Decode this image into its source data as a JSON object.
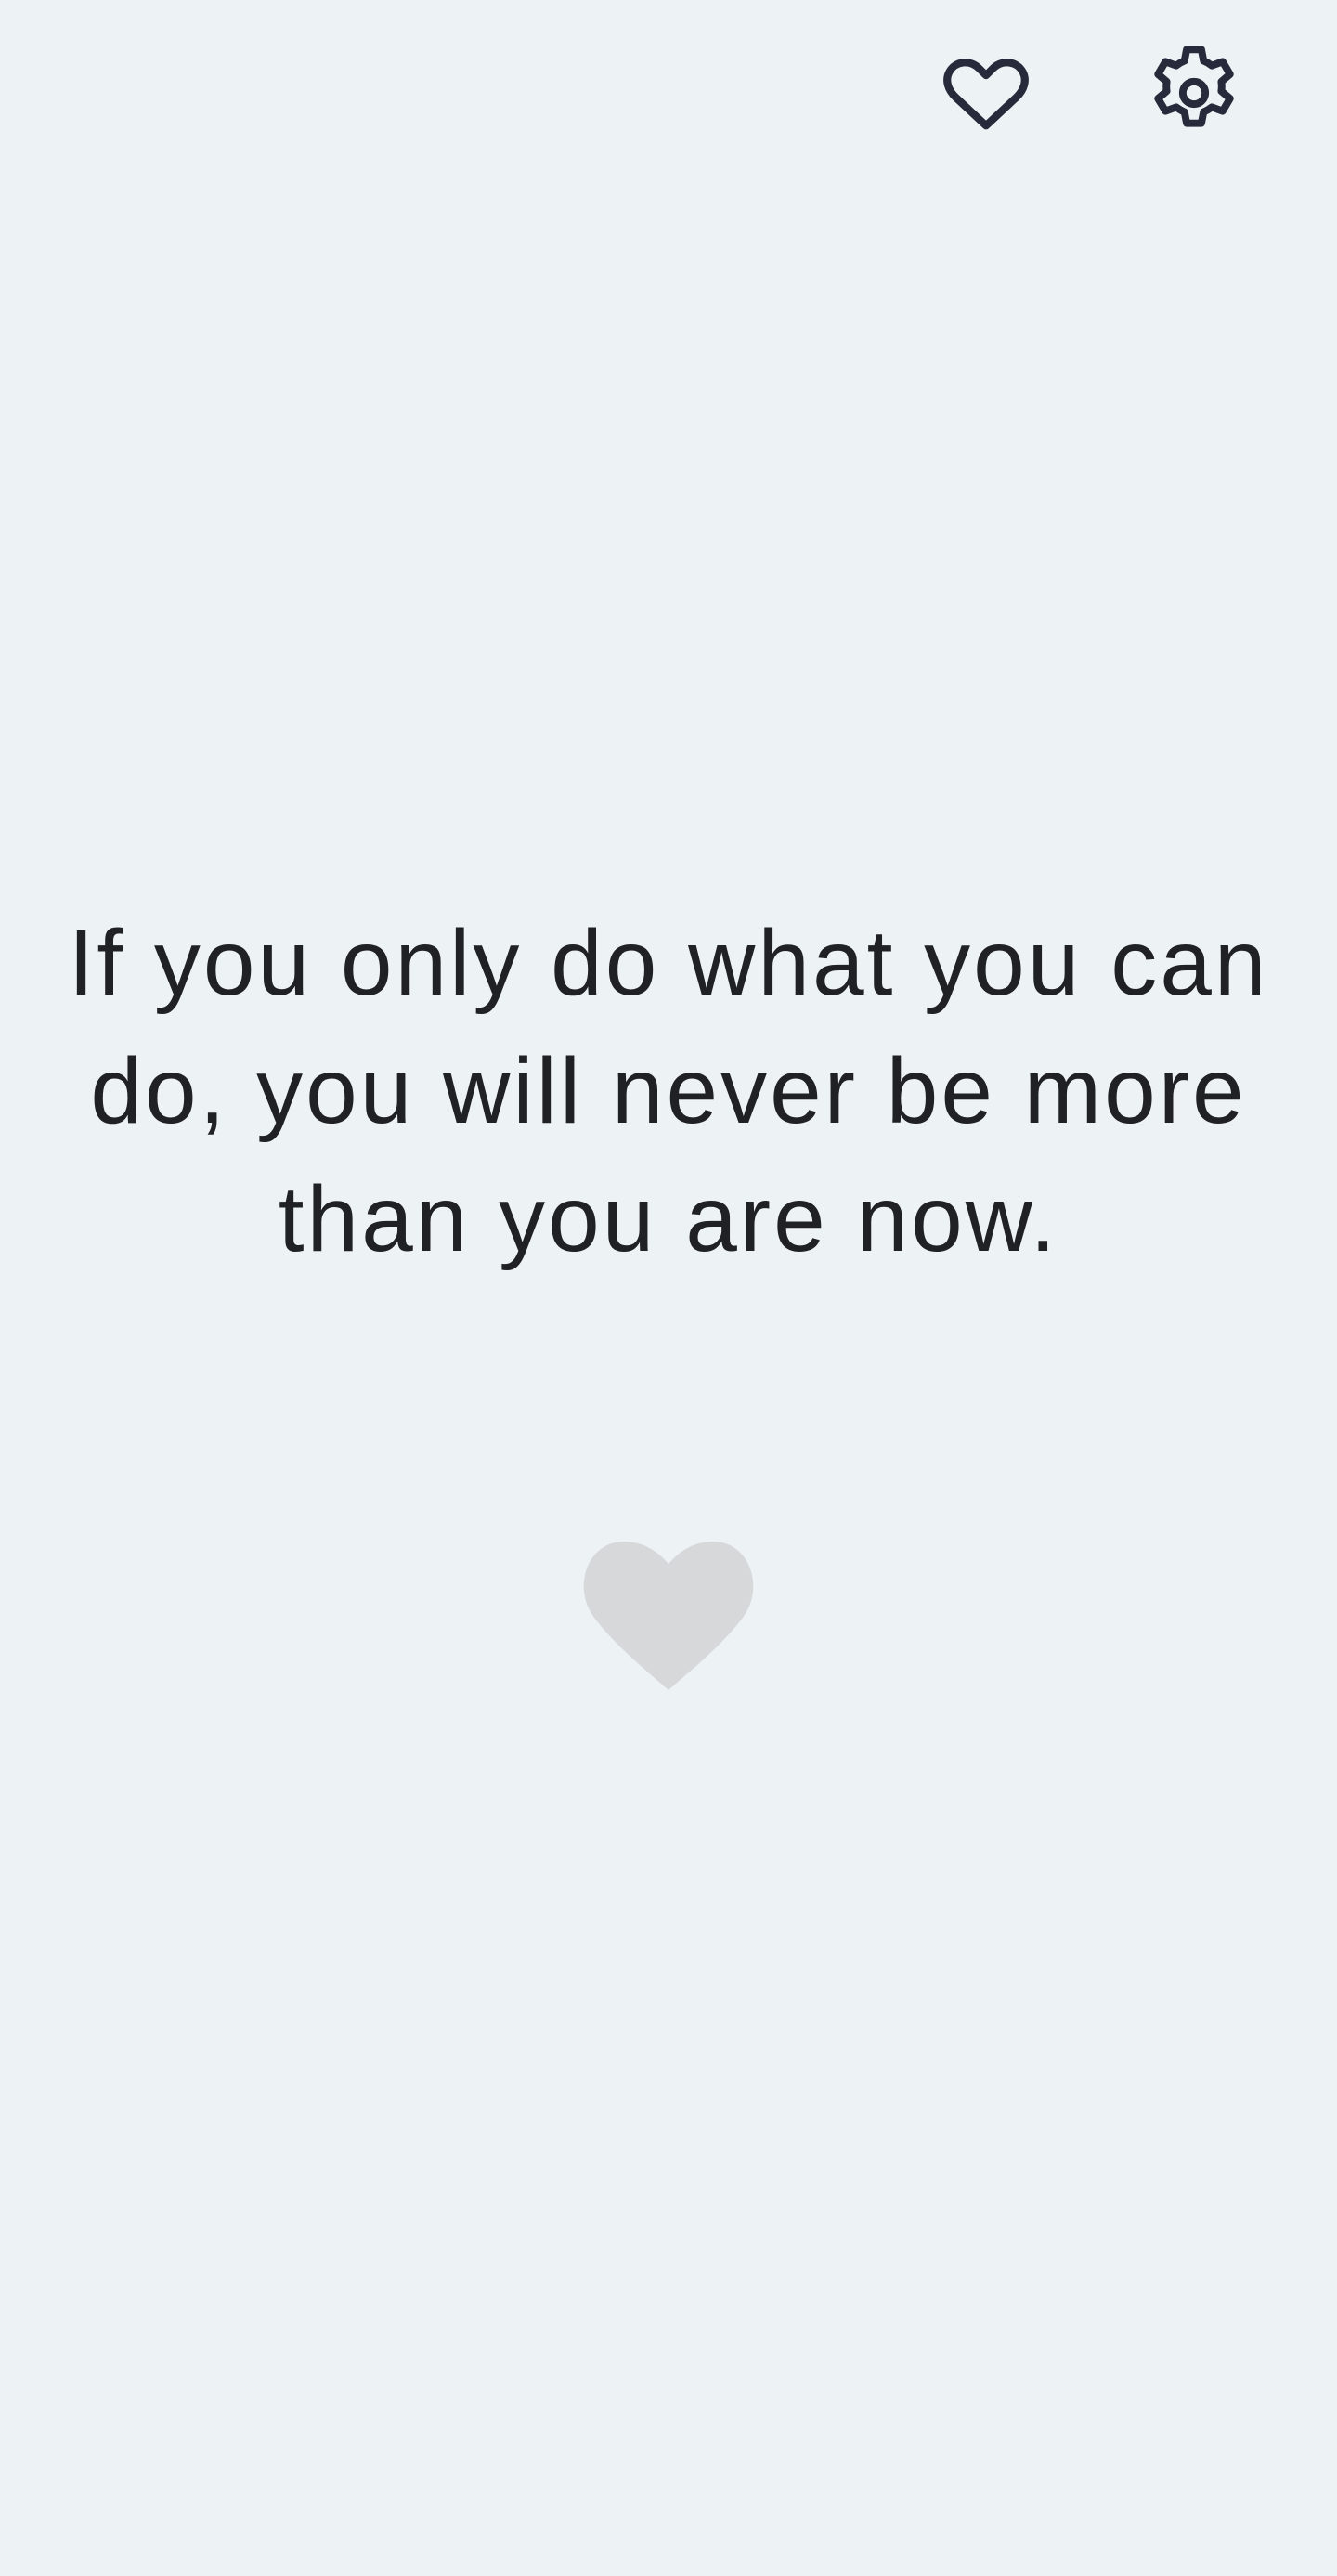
{
  "colors": {
    "background": "#edf2f5",
    "icon_stroke": "#272a3a",
    "quote_text": "#202124",
    "like_fill": "#d7d8da"
  },
  "header": {
    "favorites_icon": "heart-outline-icon",
    "settings_icon": "gear-icon"
  },
  "quote": {
    "text": "If you only do what you can do, you will never be more than you are now."
  },
  "like_button": {
    "icon": "heart-filled-icon",
    "liked": false
  }
}
